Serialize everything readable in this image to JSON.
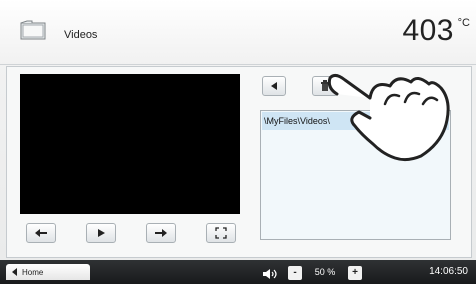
{
  "header": {
    "title": "Videos",
    "temperature": "403",
    "temperature_unit": "°C",
    "icon": "folder-icon"
  },
  "player": {
    "controls": [
      "previous-icon",
      "play-icon",
      "next-icon",
      "fullscreen-icon"
    ]
  },
  "file_browser": {
    "controls": [
      "back-icon",
      "delete-icon"
    ],
    "path": "\\MyFiles\\Videos\\"
  },
  "footer": {
    "home_label": "Home",
    "volume_minus": "-",
    "volume_plus": "+",
    "volume_label": "50 %",
    "time": "14:06:50"
  },
  "colors": {
    "header_bg": "#ffffff",
    "footer_bg": "#1f2123",
    "selection_bg": "#cfe5f4",
    "video_bg": "#000000"
  }
}
